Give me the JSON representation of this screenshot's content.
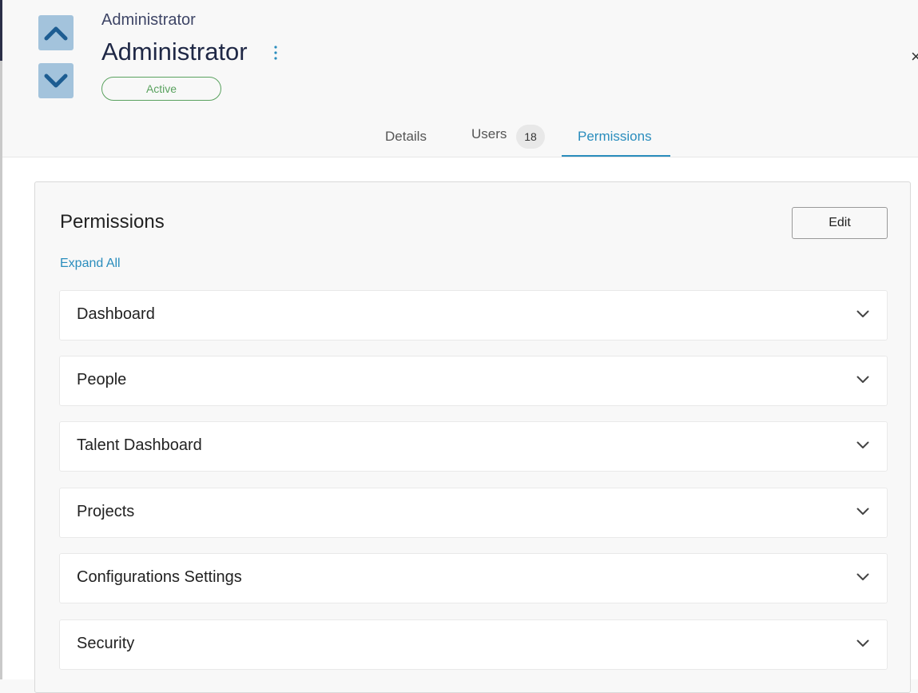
{
  "header": {
    "subtitle": "Administrator",
    "title": "Administrator",
    "status": "Active",
    "close_glyph": "×"
  },
  "tabs": [
    {
      "label": "Details",
      "active": false
    },
    {
      "label": "Users",
      "count": "18",
      "active": false
    },
    {
      "label": "Permissions",
      "active": true
    }
  ],
  "permissions": {
    "title": "Permissions",
    "edit_label": "Edit",
    "expand_all_label": "Expand All",
    "sections": [
      {
        "label": "Dashboard"
      },
      {
        "label": "People"
      },
      {
        "label": "Talent Dashboard"
      },
      {
        "label": "Projects"
      },
      {
        "label": "Configurations Settings"
      },
      {
        "label": "Security"
      }
    ]
  },
  "colors": {
    "accent": "#2a8dbd",
    "status_green": "#5aa25f",
    "nav_button_bg": "#a3c3dc",
    "nav_icon": "#1d5d92"
  },
  "icons": {
    "nav_up": "chevron-up-icon",
    "nav_down": "chevron-down-icon",
    "more": "kebab-menu-icon",
    "section_toggle": "chevron-down-icon"
  }
}
